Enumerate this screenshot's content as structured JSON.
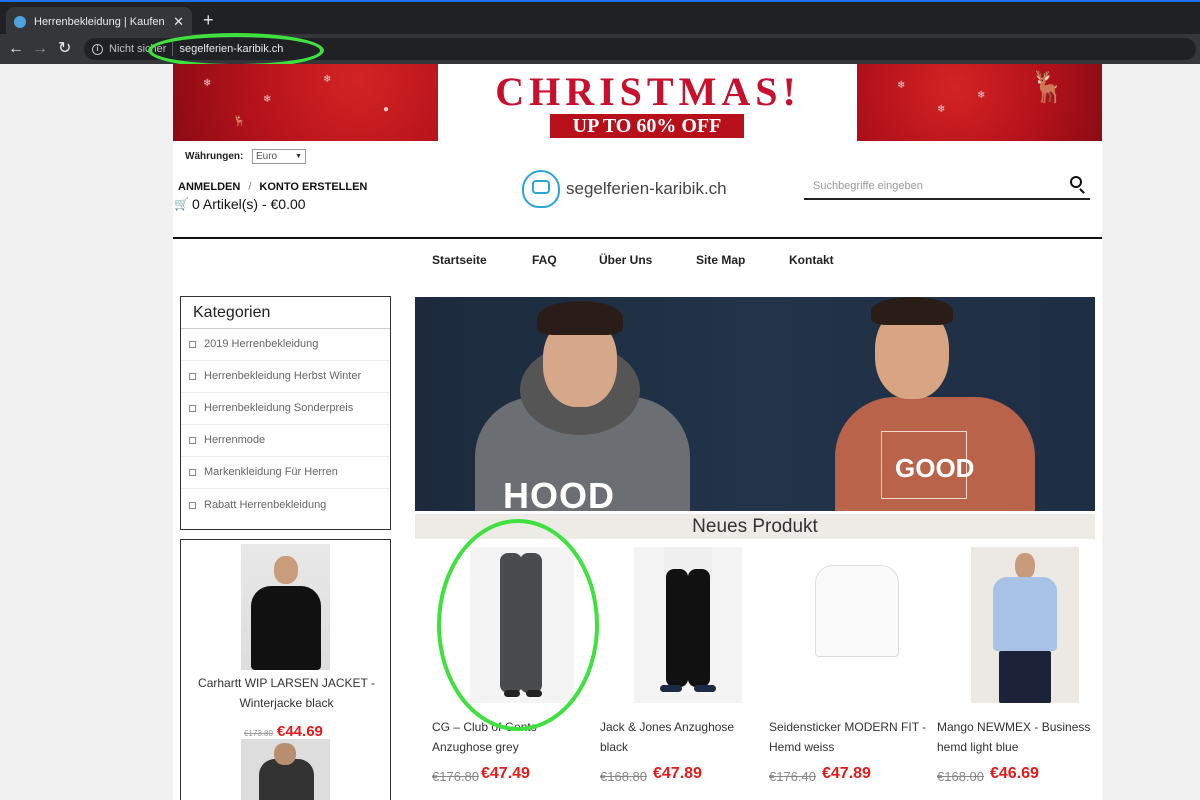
{
  "browser": {
    "tab_title": "Herrenbekleidung | Kaufen Sie Bi",
    "new_tab": "+",
    "close": "✕",
    "security_label": "Nicht sicher",
    "url": "segelferien-karibik.ch"
  },
  "banner": {
    "headline": "CHRISTMAS!",
    "sale": "UP TO 60% OFF"
  },
  "header": {
    "currency_label": "Währungen:",
    "currency_value": "Euro",
    "login": "ANMELDEN",
    "separator": "/",
    "register": "KONTO ERSTELLEN",
    "cart": "0 Artikel(s) - €0.00",
    "logo_text": "segelferien-karibik.ch",
    "search_placeholder": "Suchbegriffe eingeben"
  },
  "nav": [
    "Startseite",
    "FAQ",
    "Über Uns",
    "Site Map",
    "Kontakt"
  ],
  "sidebar": {
    "title": "Kategorien",
    "items": [
      "2019 Herrenbekleidung",
      "Herrenbekleidung Herbst Winter",
      "Herrenbekleidung Sonderpreis",
      "Herrenmode",
      "Markenkleidung Für Herren",
      "Rabatt Herrenbekleidung"
    ]
  },
  "promo": {
    "name": "Carhartt WIP LARSEN JACKET - Winterjacke black",
    "old_price": "€173.80",
    "new_price": "€44.69"
  },
  "hero": {
    "hood_text": "HOOD",
    "good_text": "GOOD"
  },
  "section_title": "Neues Produkt",
  "products": [
    {
      "name": "CG – Club of Gents Anzughose grey",
      "old_price": "€176.80",
      "new_price": "€47.49"
    },
    {
      "name": "Jack & Jones Anzughose black",
      "old_price": "€168.80",
      "new_price": "€47.89"
    },
    {
      "name": "Seidensticker MODERN FIT - Hemd weiss",
      "old_price": "€176.40",
      "new_price": "€47.89"
    },
    {
      "name": "Mango NEWMEX - Business hemd light blue",
      "old_price": "€168.00",
      "new_price": "€46.69"
    }
  ],
  "colors": {
    "price_red": "#e31b1b",
    "annotation_green": "#3fe13f",
    "banner_red": "#c8102e",
    "logo_blue": "#29a6d8"
  }
}
